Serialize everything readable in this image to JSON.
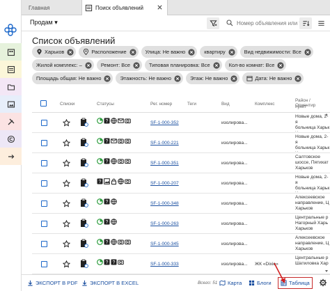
{
  "tabs": {
    "home": "Главная",
    "active": "Поиск объявлений"
  },
  "toolbar": {
    "deal_type": "Продам ▾",
    "search_placeholder": "Номер объявления или т"
  },
  "page_title": "Список объявлений",
  "chips": [
    [
      {
        "label": "Харьков",
        "icon": "pin-icon"
      },
      {
        "label": "Расположение",
        "icon": "pin-icon"
      },
      {
        "label": "Улица: Не важно"
      },
      {
        "label": "квартиру"
      },
      {
        "label": "Вид недвижимости: Все"
      }
    ],
    [
      {
        "label": "Жилой комплекс: –"
      },
      {
        "label": "Ремонт: Все"
      },
      {
        "label": "Типовая планировка: Все"
      },
      {
        "label": "Кол-во комнат: Все"
      }
    ],
    [
      {
        "label": "Площадь общая: Не важно"
      },
      {
        "label": "Этажность: Не важно"
      },
      {
        "label": "Этаж: Не важно"
      },
      {
        "label": "Дата: Не важно",
        "icon": "calendar-icon"
      }
    ]
  ],
  "columns": {
    "lists": "Списки",
    "statuses": "Статусы",
    "reg_number": "Рег. номер",
    "tags": "Теги",
    "kind": "Вид",
    "complex": "Комплекс",
    "district": "Район / Ориентир",
    "district_line2": "пункт"
  },
  "rows": [
    {
      "reg": "SF-1-000-352",
      "kind": "изолирова...",
      "complex": "",
      "area": [
        "Новые дома, 2-я",
        "больница Харьк",
        "Харьков"
      ]
    },
    {
      "reg": "SF-1-000-221",
      "kind": "изолирова...",
      "complex": "",
      "area": [
        "Новые дома, 2-я",
        "больница Харьк",
        "Харьков"
      ]
    },
    {
      "reg": "SF-1-000-351",
      "kind": "изолирова...",
      "complex": "",
      "area": [
        "Салтовское",
        "шоссе, Пятихат",
        "Харьков"
      ]
    },
    {
      "reg": "SF-1-000-207",
      "kind": "изолирова...",
      "complex": "",
      "area": [
        "Новые дома, 2-я",
        "больница Харьк",
        "Харьков"
      ]
    },
    {
      "reg": "SF-1-000-348",
      "kind": "изолирова...",
      "complex": "",
      "area": [
        "Алексеевское",
        "направление, Ц",
        "Харьков"
      ]
    },
    {
      "reg": "SF-1-000-263",
      "kind": "изолирова...",
      "complex": "",
      "area": [
        "Центральные р",
        "Нагорный Харь",
        "Харьков"
      ]
    },
    {
      "reg": "SF-1-000-345",
      "kind": "изолирова...",
      "complex": "",
      "area": [
        "Алексеевское",
        "направление, Ц",
        "Харьков"
      ]
    },
    {
      "reg": "SF-1-000-333",
      "kind": "изолирова...",
      "complex": "ЖК «Dixie»",
      "area": [
        "Центральные р",
        "Шатиловка Хар"
      ]
    }
  ],
  "footer": {
    "export_pdf": "ЭКСПОРТ В PDF",
    "export_excel": "ЭКСПОРТ В EXCEL",
    "total": "Всего: 51",
    "map": "Карта",
    "blogs": "Блоги",
    "table": "Таблица"
  },
  "colors": {
    "accent": "#1a66c9",
    "link": "#1a4fa0",
    "highlight": "#c62828",
    "status_green": "#2e9e3e"
  },
  "rail_icons": [
    "logo-icon",
    "building-icon",
    "list-icon",
    "folder-icon",
    "image-icon",
    "tools-icon",
    "copyright-icon",
    "export-icon"
  ]
}
